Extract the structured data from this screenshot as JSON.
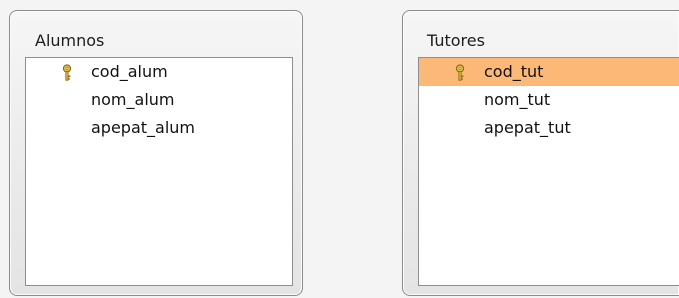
{
  "tables": [
    {
      "title": "Alumnos",
      "fields": [
        {
          "name": "cod_alum",
          "primary_key": true,
          "selected": false
        },
        {
          "name": "nom_alum",
          "primary_key": false,
          "selected": false
        },
        {
          "name": "apepat_alum",
          "primary_key": false,
          "selected": false
        }
      ]
    },
    {
      "title": "Tutores",
      "fields": [
        {
          "name": "cod_tut",
          "primary_key": true,
          "selected": true
        },
        {
          "name": "nom_tut",
          "primary_key": false,
          "selected": false
        },
        {
          "name": "apepat_tut",
          "primary_key": false,
          "selected": false
        }
      ]
    }
  ],
  "colors": {
    "selected_row": "#fcb876",
    "key_icon": "#d4a017"
  },
  "icons": {
    "primary_key": "key-icon"
  }
}
